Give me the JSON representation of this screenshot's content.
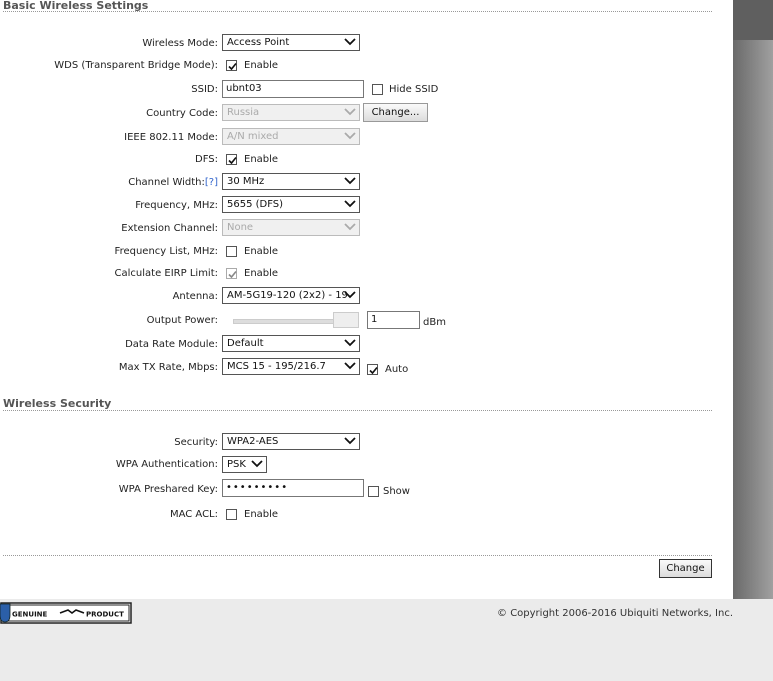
{
  "basic": {
    "title": "Basic Wireless Settings",
    "wireless_mode_label": "Wireless Mode:",
    "wireless_mode_value": "Access Point",
    "wds_label": "WDS (Transparent Bridge Mode):",
    "wds_enable": "Enable",
    "ssid_label": "SSID:",
    "ssid_value": "ubnt03",
    "hide_ssid": "Hide SSID",
    "country_label": "Country Code:",
    "country_value": "Russia",
    "change_button": "Change...",
    "ieee_label": "IEEE 802.11 Mode:",
    "ieee_value": "A/N mixed",
    "dfs_label": "DFS:",
    "dfs_enable": "Enable",
    "channel_width_label": "Channel Width:",
    "channel_width_help": "[?]",
    "channel_width_value": "30 MHz",
    "frequency_label": "Frequency, MHz:",
    "frequency_value": "5655 (DFS)",
    "extension_label": "Extension Channel:",
    "extension_value": "None",
    "freq_list_label": "Frequency List, MHz:",
    "freq_list_enable": "Enable",
    "erp_label": "Calculate EIRP Limit:",
    "erp_enable": "Enable",
    "antenna_label": "Antenna:",
    "antenna_value": "AM-5G19-120 (2x2) - 19",
    "output_power_label": "Output Power:",
    "output_power_value": "1",
    "output_power_unit": "dBm",
    "data_rate_label": "Data Rate Module:",
    "data_rate_value": "Default",
    "max_tx_label": "Max TX Rate, Mbps:",
    "max_tx_value": "MCS 15 - 195/216.7",
    "max_tx_auto": "Auto"
  },
  "security": {
    "title": "Wireless Security",
    "security_label": "Security:",
    "security_value": "WPA2-AES",
    "wpa_auth_label": "WPA Authentication:",
    "wpa_auth_value": "PSK",
    "wpa_key_label": "WPA Preshared Key:",
    "wpa_key_value": "•••••••••",
    "show_label": "Show",
    "mac_acl_label": "MAC ACL:",
    "mac_acl_enable": "Enable"
  },
  "actions": {
    "change_label": "Change"
  },
  "footer": {
    "badge_left": "GENUINE",
    "badge_right": "PRODUCT",
    "copyright": "© Copyright 2006-2016 Ubiquiti Networks, Inc."
  },
  "colors": {
    "help_link": "#3366cc",
    "sidebar": "#7a7a7a",
    "footer_bg": "#ebebeb"
  }
}
